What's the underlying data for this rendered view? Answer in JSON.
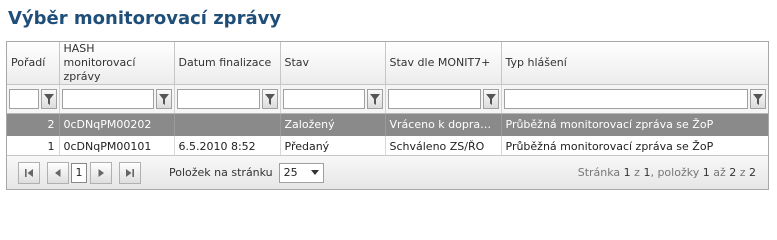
{
  "title": "Výběr monitorovací zprávy",
  "columns": [
    "Pořadí",
    "HASH monitorovací zprávy",
    "Datum finalizace",
    "Stav",
    "Stav dle MONIT7+",
    "Typ hlášení"
  ],
  "rows": [
    {
      "poradi": "2",
      "hash": "0cDNqPM00202",
      "datum": "",
      "stav": "Založený",
      "stav_monit": "Vráceno k doprac...",
      "typ": "Průběžná monitorovací zpráva se ŽoP",
      "selected": true
    },
    {
      "poradi": "1",
      "hash": "0cDNqPM00101",
      "datum": "6.5.2010 8:52",
      "stav": "Předaný",
      "stav_monit": "Schváleno ZS/ŘO",
      "typ": "Průběžná monitorovací zpráva se ŽoP",
      "selected": false
    }
  ],
  "pager": {
    "current_page": "1",
    "page_size_label": "Položek na stránku",
    "page_size": "25",
    "info_pre1": "Stránka ",
    "page": "1",
    "info_pre2": " z ",
    "pages": "1",
    "info_pre3": ", položky ",
    "from": "1",
    "info_pre4": " až ",
    "to": "2",
    "info_pre5": " z ",
    "total": "2"
  },
  "icons": {
    "filter": "filter-icon",
    "first": "first-page-icon",
    "prev": "prev-page-icon",
    "next": "next-page-icon",
    "last": "last-page-icon",
    "dropdown": "chevron-down-icon"
  },
  "colors": {
    "title": "#1f4e79",
    "selected_row": "#8a8a8a"
  }
}
